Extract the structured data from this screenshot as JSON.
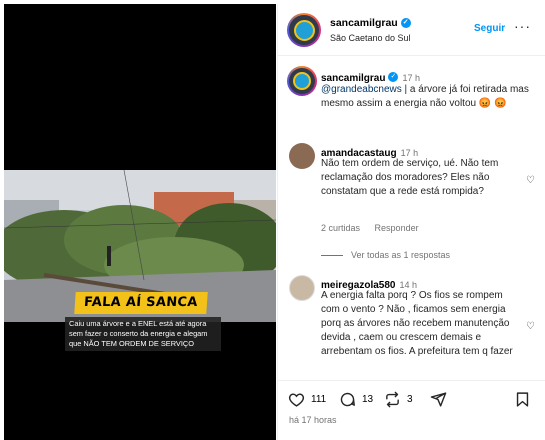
{
  "post": {
    "username": "sancamilgrau",
    "location": "São Caetano do Sul",
    "follow_label": "Seguir",
    "more_label": "···",
    "time_ago": "há 17 horas"
  },
  "media": {
    "headline": "FALA AÍ SANCA",
    "caption": "Caiu uma árvore e a ENEL está até agora sem fazer o conserto da energia e alegam que NÃO TEM ORDEM DE SERVIÇO"
  },
  "caption_comment": {
    "username": "sancamilgrau",
    "time": "17 h",
    "mention": "@grandeabcnews",
    "text": " | a árvore já foi retirada mas mesmo assim a energia não voltou",
    "emoji": "😡 😡"
  },
  "comments": [
    {
      "username": "amandacastaug",
      "time": "17 h",
      "text": "Não tem ordem de serviço, ué. Não tem reclamação dos moradores? Eles não constatam que a rede está rompida?",
      "likes": "2 curtidas",
      "reply": "Responder",
      "view_replies": "Ver todas as 1 respostas"
    },
    {
      "username": "meiregazola580",
      "time": "14 h",
      "text": "A energia falta porq ? Os fios se rompem com o vento ? Não , ficamos sem energia porq as árvores não recebem manutenção devida , caem ou crescem demais e arrebentam os fios. A prefeitura tem q fazer"
    }
  ],
  "actions": {
    "likes": "111",
    "comments": "13",
    "reposts": "3"
  },
  "icons": {
    "verified": "verified-badge-icon",
    "like": "heart-icon",
    "comment": "comment-icon",
    "repost": "repost-icon",
    "share": "send-icon",
    "save": "bookmark-icon"
  },
  "colors": {
    "link": "#0095f6",
    "headline_bg": "#f2c21a"
  }
}
